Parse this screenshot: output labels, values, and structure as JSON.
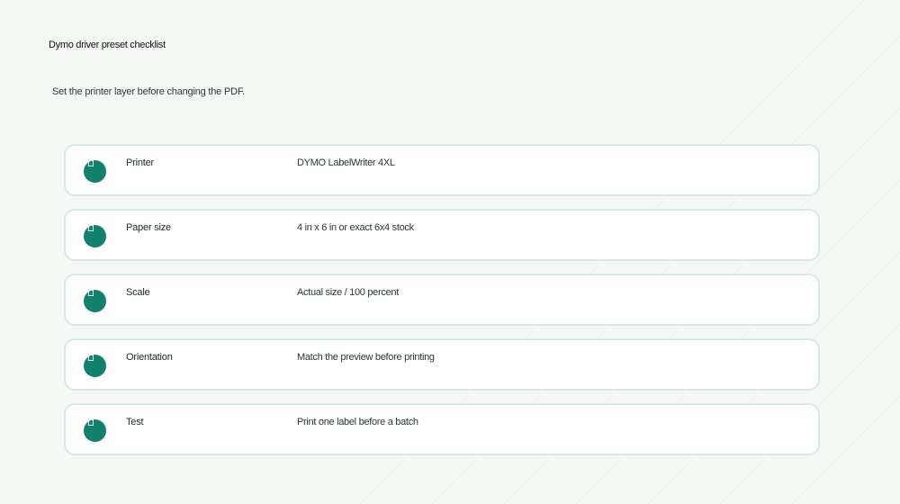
{
  "page": {
    "title": "Dymo driver preset checklist",
    "subtitle": "Set the printer layer before changing the PDF."
  },
  "checklist": {
    "items": [
      {
        "label": "Printer",
        "value": "DYMO LabelWriter 4XL",
        "icon": "check-circle-icon"
      },
      {
        "label": "Paper size",
        "value": "4 in x 6 in or exact 6x4 stock",
        "icon": "check-circle-icon"
      },
      {
        "label": "Scale",
        "value": "Actual size / 100 percent",
        "icon": "check-circle-icon"
      },
      {
        "label": "Orientation",
        "value": "Match the preview before printing",
        "icon": "check-circle-icon"
      },
      {
        "label": "Test",
        "value": "Print one label before a batch",
        "icon": "check-circle-icon"
      }
    ]
  },
  "colors": {
    "background": "#f6f8f6",
    "card_border": "#d7e8e6",
    "accent": "#12806d"
  }
}
